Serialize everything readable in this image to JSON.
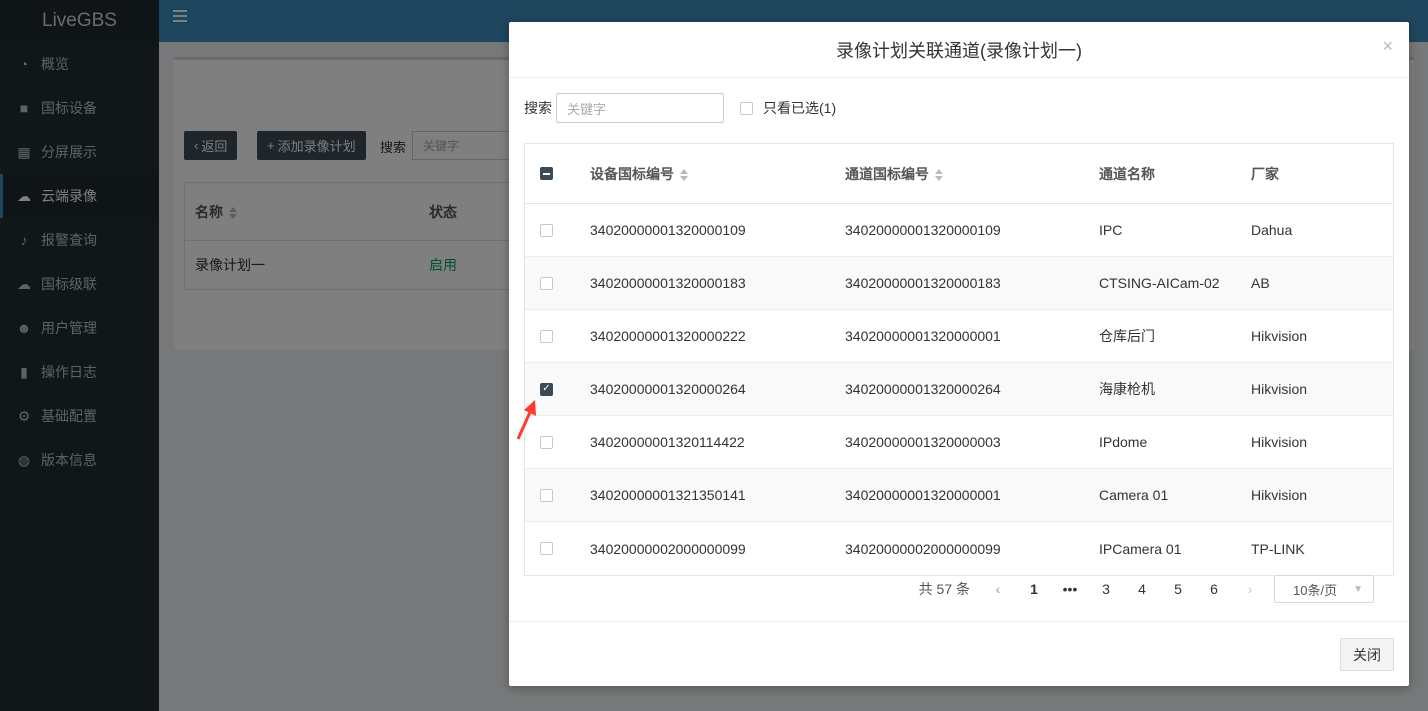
{
  "app": {
    "brand": "LiveGBS"
  },
  "sidebar": {
    "items": [
      {
        "label": "概览",
        "icon": "dashboard-icon"
      },
      {
        "label": "国标设备",
        "icon": "video-camera-icon"
      },
      {
        "label": "分屏展示",
        "icon": "grid-icon"
      },
      {
        "label": "云端录像",
        "icon": "cloud-icon",
        "active": true
      },
      {
        "label": "报警查询",
        "icon": "bell-icon"
      },
      {
        "label": "国标级联",
        "icon": "cloud-upload-icon"
      },
      {
        "label": "用户管理",
        "icon": "users-icon"
      },
      {
        "label": "操作日志",
        "icon": "file-icon"
      },
      {
        "label": "基础配置",
        "icon": "gears-icon"
      },
      {
        "label": "版本信息",
        "icon": "globe-icon"
      }
    ]
  },
  "background_page": {
    "back_button": "返回",
    "add_button": "添加录像计划",
    "search_label": "搜索",
    "search_placeholder": "关键字",
    "columns": {
      "name": "名称",
      "status": "状态"
    },
    "rows": [
      {
        "name": "录像计划一",
        "status": "启用"
      }
    ]
  },
  "modal": {
    "title": "录像计划关联通道(录像计划一)",
    "close_symbol": "×",
    "search_label": "搜索",
    "search_placeholder": "关键字",
    "only_selected_label": "只看已选(1)",
    "columns": {
      "device_id": "设备国标编号",
      "channel_id": "通道国标编号",
      "channel_name": "通道名称",
      "vendor": "厂家"
    },
    "rows": [
      {
        "checked": false,
        "device_id": "34020000001320000109",
        "channel_id": "34020000001320000109",
        "channel_name": "IPC",
        "vendor": "Dahua"
      },
      {
        "checked": false,
        "device_id": "34020000001320000183",
        "channel_id": "34020000001320000183",
        "channel_name": "CTSING-AICam-02",
        "vendor": "AB"
      },
      {
        "checked": false,
        "device_id": "34020000001320000222",
        "channel_id": "34020000001320000001",
        "channel_name": "仓库后门",
        "vendor": "Hikvision"
      },
      {
        "checked": true,
        "device_id": "34020000001320000264",
        "channel_id": "34020000001320000264",
        "channel_name": "海康枪机",
        "vendor": "Hikvision"
      },
      {
        "checked": false,
        "device_id": "34020000001320114422",
        "channel_id": "34020000001320000003",
        "channel_name": "IPdome",
        "vendor": "Hikvision"
      },
      {
        "checked": false,
        "device_id": "34020000001321350141",
        "channel_id": "34020000001320000001",
        "channel_name": "Camera 01",
        "vendor": "Hikvision"
      },
      {
        "checked": false,
        "device_id": "34020000002000000099",
        "channel_id": "34020000002000000099",
        "channel_name": "IPCamera 01",
        "vendor": "TP-LINK"
      }
    ],
    "pagination": {
      "total_text": "共 57 条",
      "prev": "‹",
      "next": "›",
      "ellipsis": "•••",
      "pages": [
        "1",
        "3",
        "4",
        "5",
        "6"
      ],
      "current_page": "1",
      "page_size": "10条/页"
    },
    "close_button": "关闭"
  },
  "colors": {
    "accent": "#3c4a56",
    "annotation": "#ff3b30"
  }
}
